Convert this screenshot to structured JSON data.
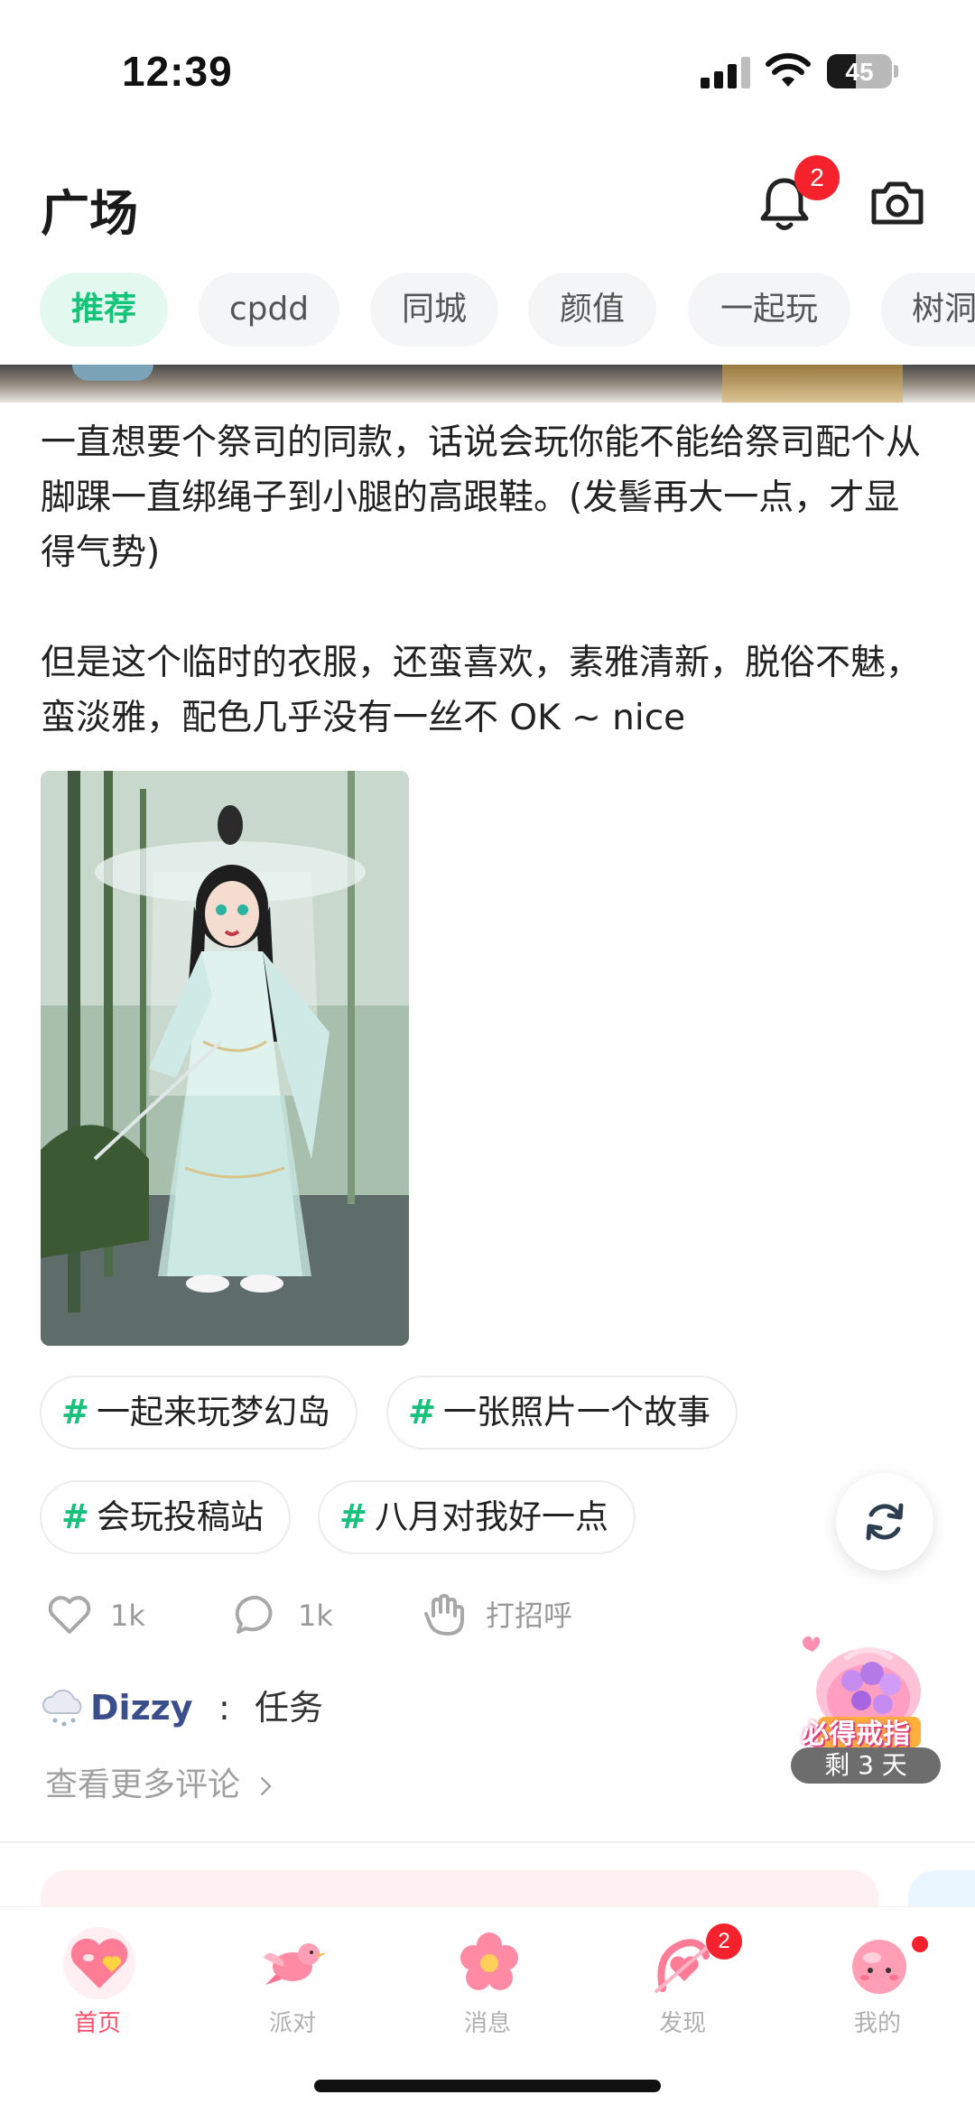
{
  "status_bar": {
    "time": "12:39",
    "battery": "45",
    "battery_level": 0.45
  },
  "header": {
    "title": "广场",
    "notification_count": "2"
  },
  "tabs": [
    {
      "label": "推荐",
      "active": true
    },
    {
      "label": "cpdd"
    },
    {
      "label": "同城"
    },
    {
      "label": "颜值"
    },
    {
      "label": "一起玩"
    },
    {
      "label": "树洞"
    }
  ],
  "post": {
    "paragraphs": [
      "一直想要个祭司的同款，话说会玩你能不能给祭司配个从脚踝一直绑绳子到小腿的高跟鞋。(发髻再大一点，才显得气势)",
      "但是这个临时的衣服，还蛮喜欢，素雅清新，脱俗不魅，蛮淡雅，配色几乎没有一丝不 OK ~ nice"
    ],
    "topics": [
      {
        "hash": "#",
        "label": "一起来玩梦幻岛"
      },
      {
        "hash": "#",
        "label": "一张照片一个故事"
      },
      {
        "hash": "#",
        "label": "会玩投稿站"
      },
      {
        "hash": "#",
        "label": "八月对我好一点"
      }
    ],
    "actions": {
      "like_count": "1k",
      "comment_count": "1k",
      "greet_label": "打招呼"
    },
    "comment": {
      "user": "Dizzy",
      "separator": ":",
      "text": "任务"
    },
    "more_comments": "查看更多评论"
  },
  "promo": {
    "title": "必得戒指",
    "timer": "剩 3 天"
  },
  "bottom_nav": [
    {
      "label": "首页",
      "active": true
    },
    {
      "label": "派对"
    },
    {
      "label": "消息"
    },
    {
      "label": "发现",
      "badge": "2"
    },
    {
      "label": "我的"
    }
  ],
  "colors": {
    "accent": "#14c47a",
    "active_tab_bg": "#e3f9ef",
    "badge": "#f5222d",
    "nav_active": "#ff4d6a"
  }
}
